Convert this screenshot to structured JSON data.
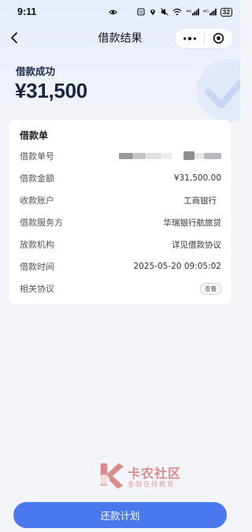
{
  "status_bar": {
    "time": "9:11",
    "network_1": "⁴ᴳ",
    "network_2": "⁴ᴳ",
    "battery": "32"
  },
  "nav": {
    "title": "借款结果"
  },
  "result": {
    "status": "借款成功",
    "amount": "¥31,500"
  },
  "card": {
    "title": "借款单",
    "rows": [
      {
        "label": "借款单号",
        "value": ""
      },
      {
        "label": "借款金额",
        "value": "¥31,500.00"
      },
      {
        "label": "收款账户",
        "value": "工商银行"
      },
      {
        "label": "借款服务方",
        "value": "华瑞银行航旅贷"
      },
      {
        "label": "放款机构",
        "value": "详见借款协议"
      },
      {
        "label": "借款时间",
        "value": "2025-05-20 09:05:02"
      },
      {
        "label": "相关协议",
        "value": "查看"
      }
    ]
  },
  "watermark": {
    "title": "卡农社区",
    "subtitle": "金融在线教育"
  },
  "footer": {
    "repay_plan_label": "还款计划"
  },
  "colors": {
    "primary": "#4c78ee",
    "page_bg": "#f3f4f8",
    "watermark": "#d26a6a"
  }
}
